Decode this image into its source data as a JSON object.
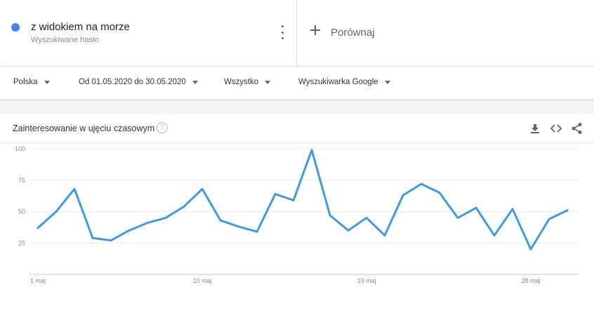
{
  "term": {
    "name": "z widokiem na morze",
    "subtitle": "Wyszukiwane hasło",
    "color": "#4285f4"
  },
  "compare": {
    "label": "Porównaj"
  },
  "filters": {
    "region": "Polska",
    "date_range": "Od 01.05.2020 do 30.05.2020",
    "category": "Wszystko",
    "search_type": "Wyszukiwarka Google"
  },
  "card": {
    "title": "Zainteresowanie w ujęciu czasowym",
    "help_icon": "?",
    "icons": [
      "download-icon",
      "embed-icon",
      "share-icon"
    ]
  },
  "chart_data": {
    "type": "line",
    "x": [
      "1 maj",
      "2 maj",
      "3 maj",
      "4 maj",
      "5 maj",
      "6 maj",
      "7 maj",
      "8 maj",
      "9 maj",
      "10 maj",
      "11 maj",
      "12 maj",
      "13 maj",
      "14 maj",
      "15 maj",
      "16 maj",
      "17 maj",
      "18 maj",
      "19 maj",
      "20 maj",
      "21 maj",
      "22 maj",
      "23 maj",
      "24 maj",
      "25 maj",
      "26 maj",
      "27 maj",
      "28 maj",
      "29 maj",
      "30 maj"
    ],
    "series": [
      {
        "color": "#3e9be0",
        "values": [
          37,
          50,
          68,
          29,
          27,
          35,
          41,
          45,
          54,
          68,
          43,
          38,
          34,
          64,
          59,
          99,
          47,
          35,
          45,
          31,
          63,
          72,
          65,
          45,
          53,
          31,
          52,
          20,
          44,
          51
        ]
      }
    ],
    "yticks": [
      25,
      50,
      75,
      100
    ],
    "xtick_labels": [
      "1 maj",
      "10 maj",
      "19 maj",
      "28 maj"
    ],
    "xtick_index": [
      0,
      9,
      18,
      27
    ],
    "ylim": [
      0,
      100
    ],
    "grid": true
  }
}
